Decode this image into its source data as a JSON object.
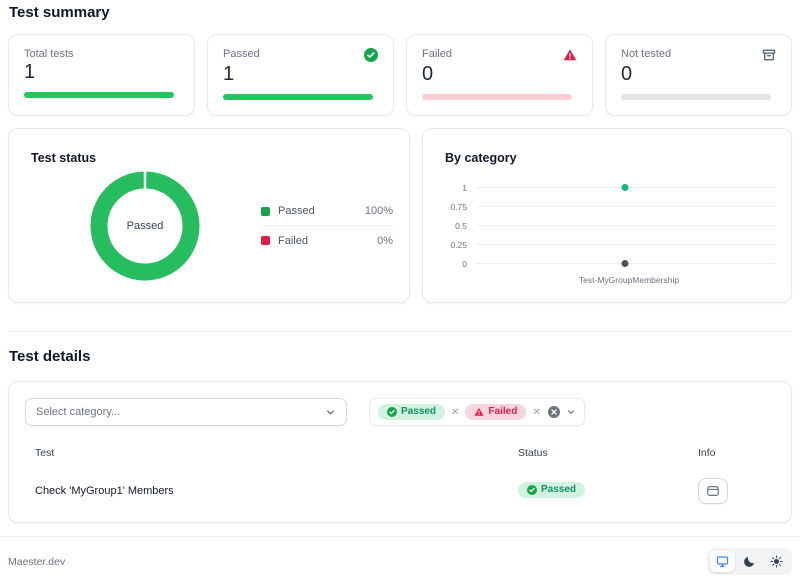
{
  "summary": {
    "title": "Test summary",
    "cards": [
      {
        "label": "Total tests",
        "value": "1",
        "icon": "none",
        "bar_percent": 100,
        "bar_color": "#22c55e"
      },
      {
        "label": "Passed",
        "value": "1",
        "icon": "check-circle",
        "bar_percent": 100,
        "bar_color": "#22c55e"
      },
      {
        "label": "Failed",
        "value": "0",
        "icon": "warning-triangle",
        "bar_percent": 0,
        "bar_color": "#fecdd3"
      },
      {
        "label": "Not tested",
        "value": "0",
        "icon": "archive-box",
        "bar_percent": 0,
        "bar_color": "#e2e4e8"
      }
    ]
  },
  "status_card": {
    "title": "Test status",
    "center_label": "Passed",
    "legend": [
      {
        "label": "Passed",
        "value": "100%",
        "color": "#16a34a"
      },
      {
        "label": "Failed",
        "value": "0%",
        "color": "#e11d48"
      }
    ]
  },
  "category_card": {
    "title": "By category",
    "yticks": [
      "1",
      "0.75",
      "0.5",
      "0.25",
      "0"
    ],
    "category": "Test-MyGroupMembership"
  },
  "chart_data": [
    {
      "type": "pie",
      "title": "Test status",
      "labels": [
        "Passed",
        "Failed"
      ],
      "values": [
        100,
        0
      ],
      "colors": [
        "#22c55e",
        "#e11d48"
      ],
      "center_label": "Passed",
      "legend_position": "right"
    },
    {
      "type": "scatter",
      "title": "By category",
      "categories": [
        "Test-MyGroupMembership"
      ],
      "points": [
        {
          "x": "Test-MyGroupMembership",
          "y": 1,
          "color": "#10b981"
        },
        {
          "x": "Test-MyGroupMembership",
          "y": 0,
          "color": "#52525b"
        }
      ],
      "ylim": [
        0,
        1
      ],
      "yticks": [
        1,
        0.75,
        0.5,
        0.25,
        0
      ],
      "grid": true
    }
  ],
  "details": {
    "title": "Test details",
    "select_placeholder": "Select category...",
    "filters": [
      {
        "label": "Passed",
        "icon": "check-circle"
      },
      {
        "label": "Failed",
        "icon": "warning-triangle"
      }
    ],
    "table": {
      "headers": [
        "Test",
        "Status",
        "Info"
      ],
      "rows": [
        {
          "test": "Check 'MyGroup1' Members",
          "status": "Passed",
          "info": "open-result"
        }
      ]
    }
  },
  "footer": {
    "brand": "Maester.dev",
    "theme_options": [
      "system",
      "dark",
      "light"
    ],
    "active_theme": "system"
  },
  "icons": {
    "remove": "✕"
  },
  "colors": {
    "green": "#22c55e",
    "green_dark": "#16a34a",
    "red": "#e11d48",
    "pink_track": "#fecdd3",
    "gray_track": "#e2e4e8",
    "accent_blue": "#3b82f6"
  }
}
